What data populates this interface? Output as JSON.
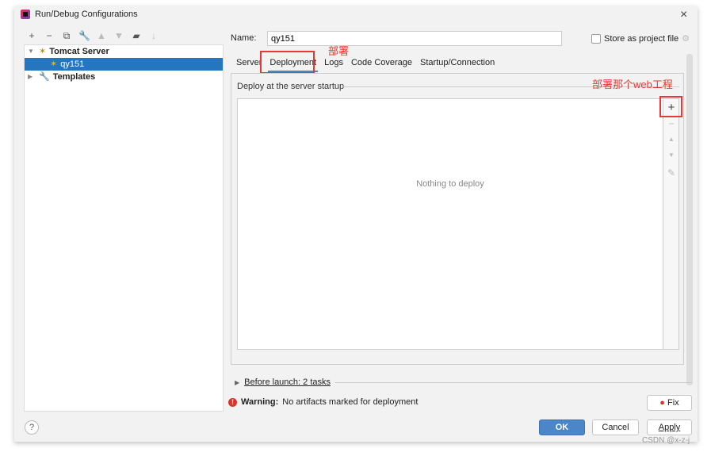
{
  "window": {
    "title": "Run/Debug Configurations"
  },
  "tree": {
    "items": [
      {
        "label": "Tomcat Server"
      },
      {
        "label": "qy151"
      },
      {
        "label": "Templates"
      }
    ]
  },
  "name": {
    "label": "Name:",
    "value": "qy151"
  },
  "store": {
    "label": "Store as project file"
  },
  "tabs": [
    "Server",
    "Deployment",
    "Logs",
    "Code Coverage",
    "Startup/Connection"
  ],
  "deploy": {
    "section": "Deploy at the server startup",
    "empty": "Nothing to deploy"
  },
  "annotations": {
    "tab": "部署",
    "add": "部署那个web工程"
  },
  "before_launch": "Before launch: 2 tasks",
  "warning": {
    "bold": "Warning:",
    "text": "No artifacts marked for deployment"
  },
  "buttons": {
    "fix": "Fix",
    "ok": "OK",
    "cancel": "Cancel",
    "apply": "Apply",
    "help": "?"
  },
  "watermark": "CSDN @x-z-j",
  "colors": {
    "accent": "#2675bf",
    "annotation": "#e53935"
  }
}
